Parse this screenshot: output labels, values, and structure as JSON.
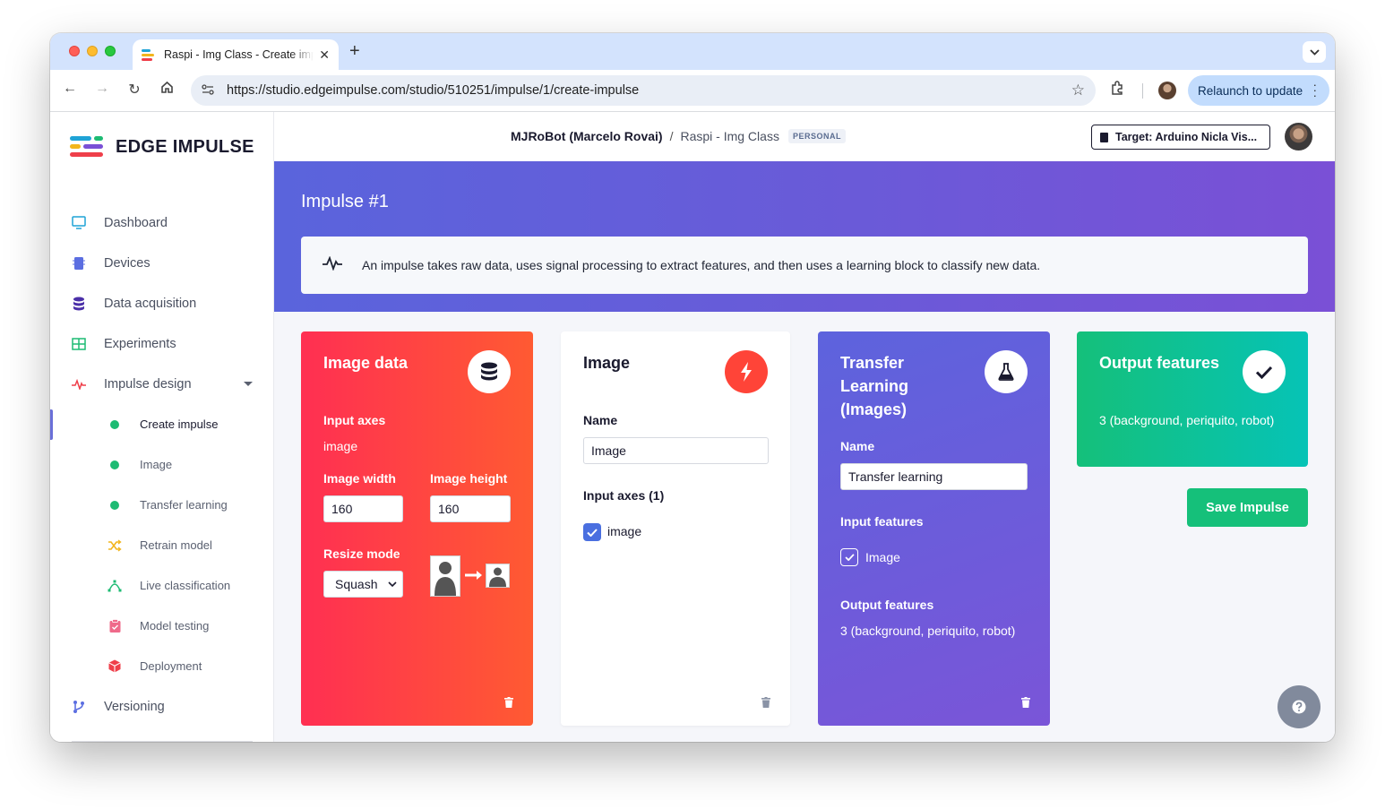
{
  "browser": {
    "tab_title": "Raspi - Img Class - Create impulse",
    "new_tab": "+",
    "url": "https://studio.edgeimpulse.com/studio/510251/impulse/1/create-impulse",
    "relaunch_label": "Relaunch to update"
  },
  "sidebar": {
    "logo_text": "EDGE IMPULSE",
    "items": [
      {
        "label": "Dashboard",
        "icon": "monitor-icon",
        "color": "#1fa3d6"
      },
      {
        "label": "Devices",
        "icon": "chip-icon",
        "color": "#5b6ee1"
      },
      {
        "label": "Data acquisition",
        "icon": "database-icon",
        "color": "#4a2fa8"
      },
      {
        "label": "Experiments",
        "icon": "grid-icon",
        "color": "#1dbb73"
      },
      {
        "label": "Impulse design",
        "icon": "pulse-icon",
        "color": "#ef3f4a"
      }
    ],
    "subitems": [
      {
        "label": "Create impulse",
        "icon": "status-dot-icon"
      },
      {
        "label": "Image",
        "icon": "status-dot-icon"
      },
      {
        "label": "Transfer learning",
        "icon": "status-dot-icon"
      },
      {
        "label": "Retrain model",
        "icon": "shuffle-icon",
        "color": "#f2b51d"
      },
      {
        "label": "Live classification",
        "icon": "vector-icon",
        "color": "#1dbb73"
      },
      {
        "label": "Model testing",
        "icon": "clipboard-check-icon",
        "color": "#ef6a8a"
      },
      {
        "label": "Deployment",
        "icon": "cube-icon",
        "color": "#ef3f4a"
      }
    ],
    "versioning": {
      "label": "Versioning",
      "icon": "branch-icon",
      "color": "#5b6ee1"
    }
  },
  "topbar": {
    "owner": "MJRoBot (Marcelo Rovai)",
    "separator": "/",
    "project": "Raspi - Img Class",
    "badge": "PERSONAL",
    "target": "Target: Arduino Nicla Vis..."
  },
  "hero": {
    "title": "Impulse #1",
    "info": "An impulse takes raw data, uses signal processing to extract features, and then uses a learning block to classify new data."
  },
  "cards": {
    "image_data": {
      "title": "Image data",
      "input_axes_label": "Input axes",
      "input_axes_value": "image",
      "width_label": "Image width",
      "width_value": "160",
      "height_label": "Image height",
      "height_value": "160",
      "resize_label": "Resize mode",
      "resize_value": "Squash"
    },
    "image": {
      "title": "Image",
      "name_label": "Name",
      "name_value": "Image",
      "axes_label": "Input axes (1)",
      "axes_item": "image"
    },
    "transfer": {
      "title_line1": "Transfer",
      "title_line2": "Learning",
      "title_line3": "(Images)",
      "name_label": "Name",
      "name_value": "Transfer learning",
      "features_label": "Input features",
      "features_item": "Image",
      "output_label": "Output features",
      "output_value": "3 (background, periquito, robot)"
    },
    "output": {
      "title": "Output features",
      "value": "3 (background, periquito, robot)"
    }
  },
  "save_label": "Save Impulse",
  "colors": {
    "accent": "#5b6ee1",
    "success": "#15c07a",
    "danger": "#ff3a4a"
  }
}
